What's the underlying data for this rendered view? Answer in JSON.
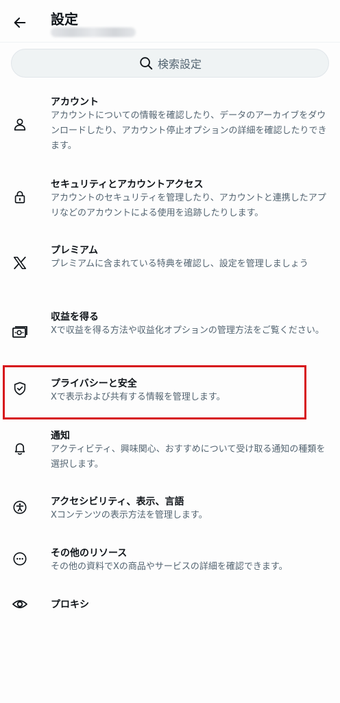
{
  "header": {
    "title": "設定"
  },
  "search": {
    "label": "検索設定"
  },
  "items": [
    {
      "title": "アカウント",
      "desc": "アカウントについての情報を確認したり、データのアーカイブをダウンロードしたり、アカウント停止オプションの詳細を確認したりできます。",
      "icon": "person-icon"
    },
    {
      "title": "セキュリティとアカウントアクセス",
      "desc": "アカウントのセキュリティを管理したり、アカウントと連携したアプリなどのアカウントによる使用を追跡したりします。",
      "icon": "lock-icon"
    },
    {
      "title": "プレミアム",
      "desc": "プレミアムに含まれている特典を確認し、設定を管理しましょう",
      "icon": "x-logo-icon"
    },
    {
      "title": "収益を得る",
      "desc": "Xで収益を得る方法や収益化オプションの管理方法をご覧ください。",
      "icon": "money-icon"
    },
    {
      "title": "プライバシーと安全",
      "desc": "Xで表示および共有する情報を管理します。",
      "icon": "shield-icon"
    },
    {
      "title": "通知",
      "desc": "アクティビティ、興味関心、おすすめについて受け取る通知の種類を選択します。",
      "icon": "bell-icon"
    },
    {
      "title": "アクセシビリティ、表示、言語",
      "desc": "Xコンテンツの表示方法を管理します。",
      "icon": "accessibility-icon"
    },
    {
      "title": "その他のリソース",
      "desc": "その他の資料でXの商品やサービスの詳細を確認できます。",
      "icon": "more-circle-icon"
    },
    {
      "title": "プロキシ",
      "desc": "",
      "icon": "eye-icon"
    }
  ],
  "colors": {
    "text": "#0f1419",
    "secondary": "#536471",
    "highlight": "#d7141c",
    "search_bg": "#eff3f4"
  }
}
